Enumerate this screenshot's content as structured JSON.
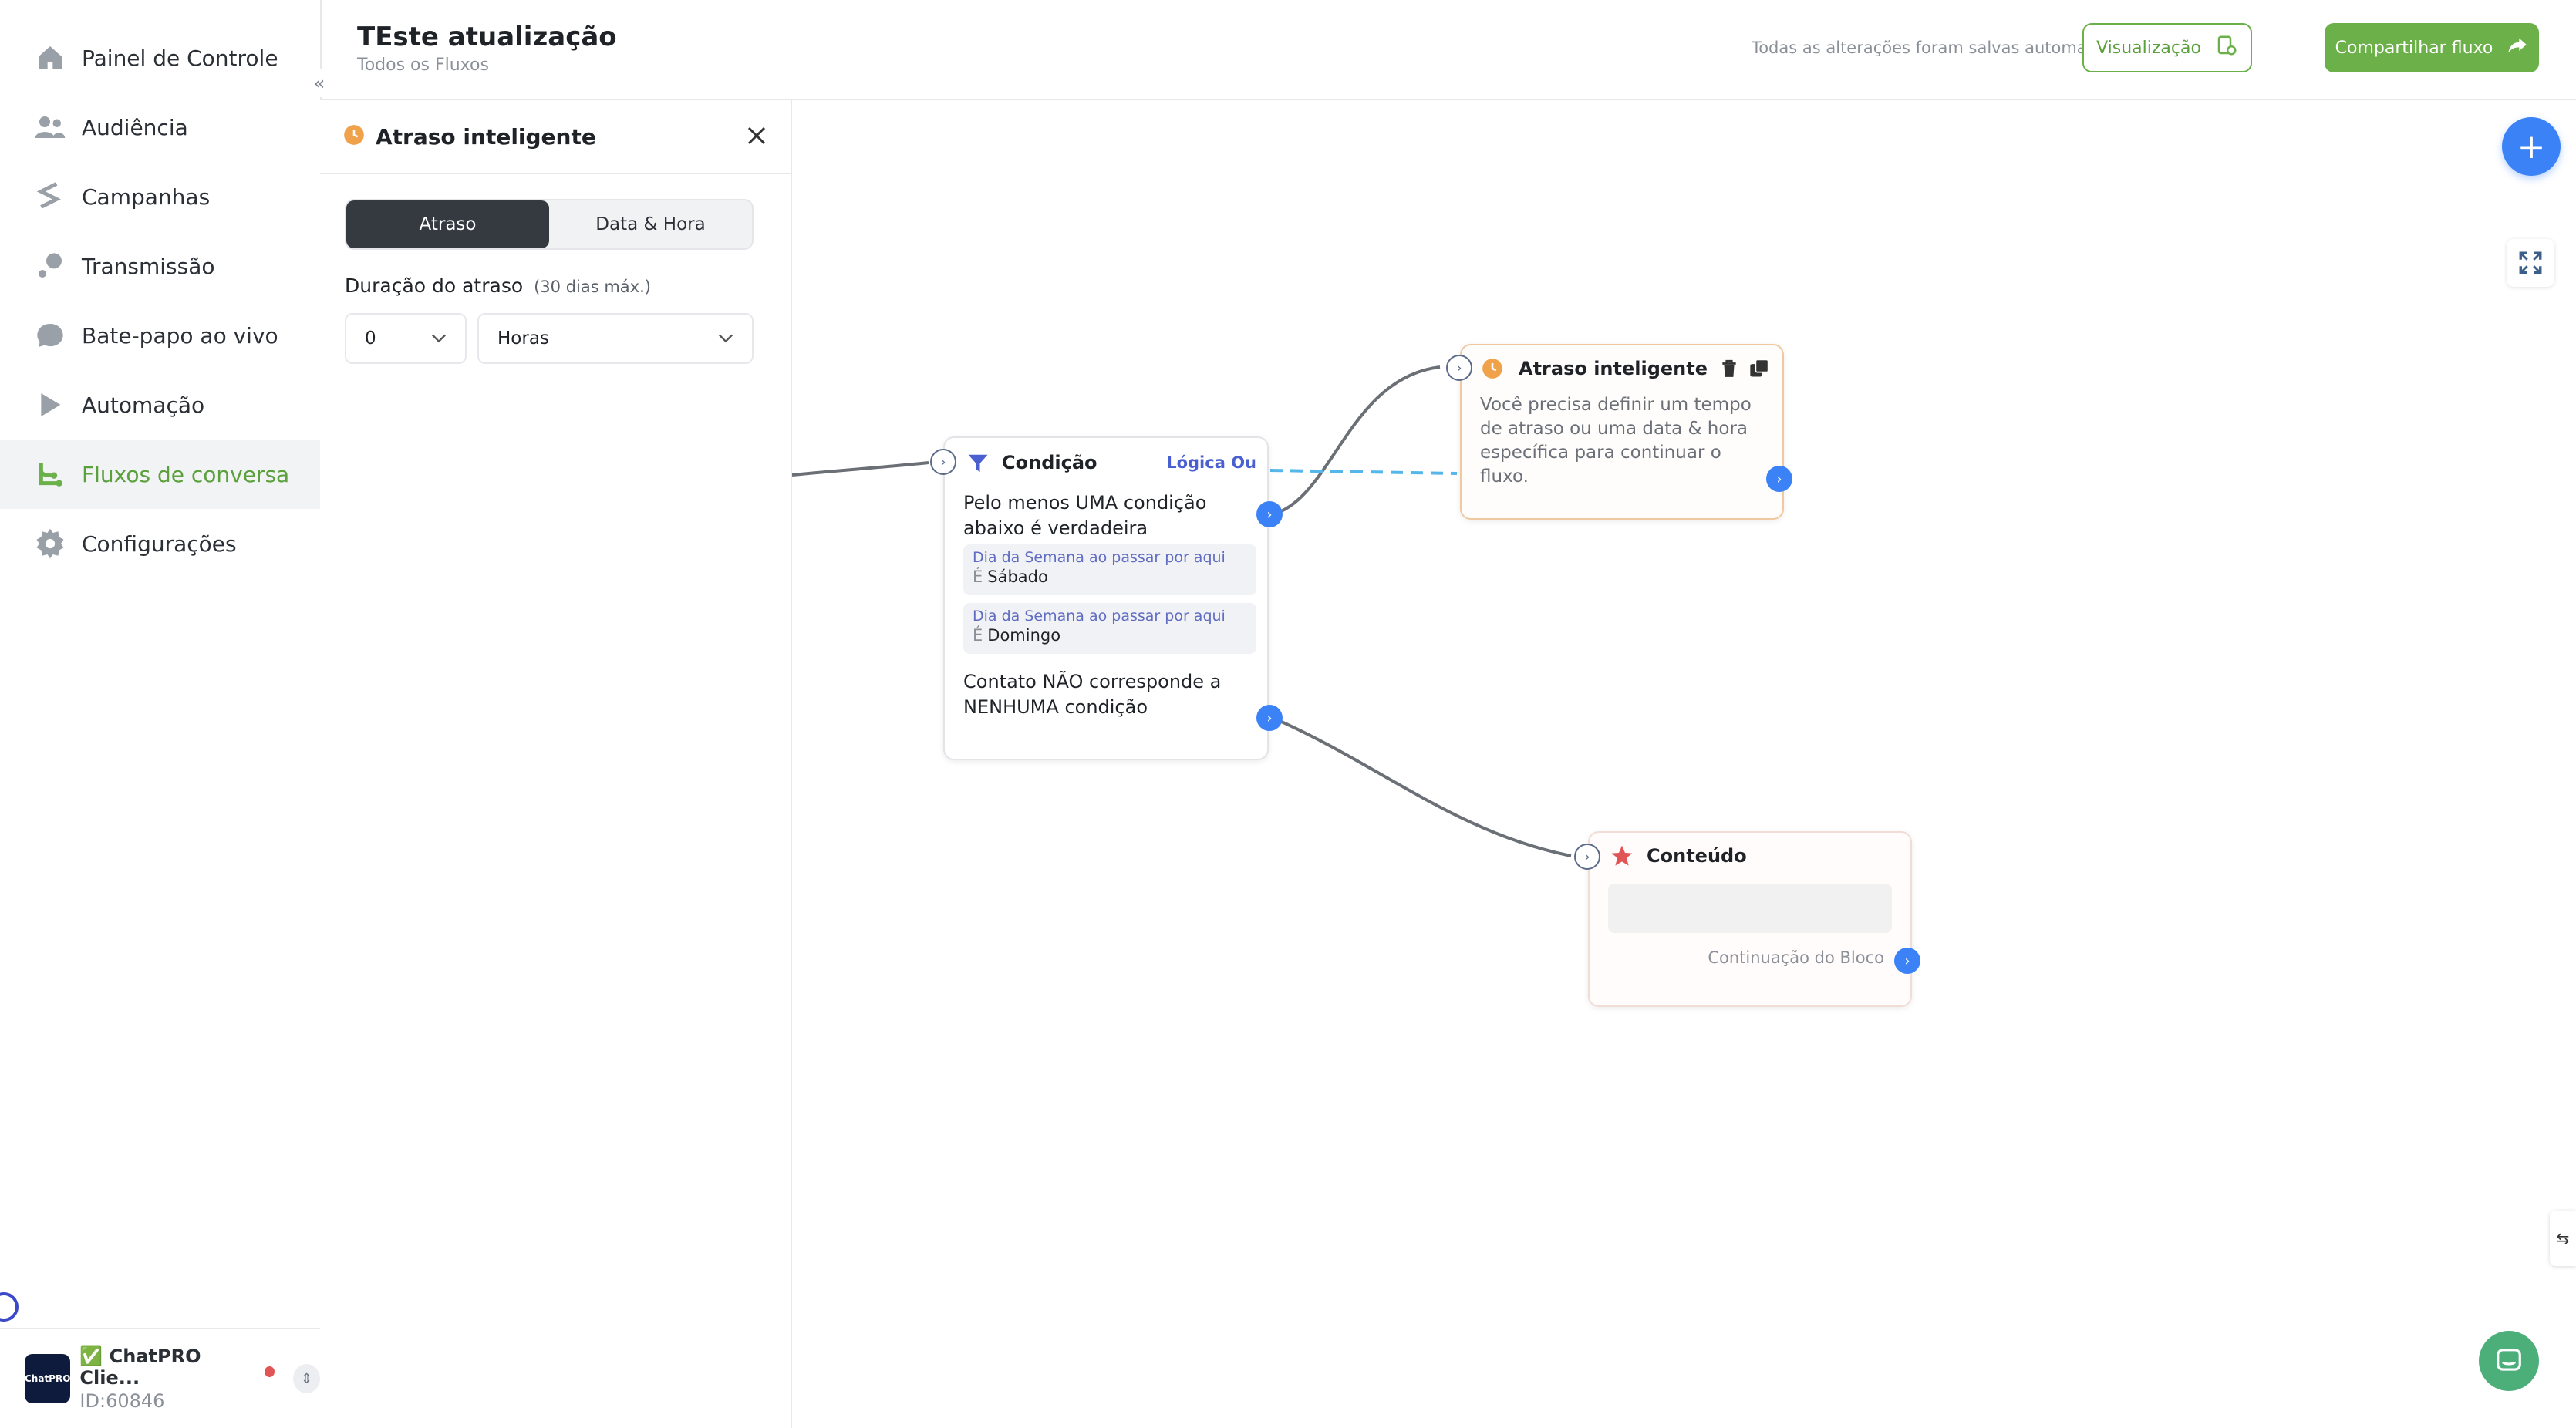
{
  "sidebar": {
    "items": [
      {
        "label": "Painel de Controle",
        "icon": "home-icon"
      },
      {
        "label": "Audiência",
        "icon": "users-icon"
      },
      {
        "label": "Campanhas",
        "icon": "campaign-icon"
      },
      {
        "label": "Transmissão",
        "icon": "broadcast-icon"
      },
      {
        "label": "Bate-papo ao vivo",
        "icon": "chat-bubble-icon"
      },
      {
        "label": "Automação",
        "icon": "play-icon"
      },
      {
        "label": "Fluxos de conversa",
        "icon": "flow-icon"
      },
      {
        "label": "Configurações",
        "icon": "gear-icon"
      }
    ],
    "active_index": 6,
    "account": {
      "name": "✅ ChatPRO Clie...",
      "id": "ID:60846",
      "avatar_text": "ChatPRO"
    }
  },
  "header": {
    "title": "TEste atualização",
    "subtitle": "Todos os Fluxos",
    "autosave": "Todas as alterações foram salvas automaticamente",
    "preview_label": "Visualização",
    "share_label": "Compartilhar fluxo"
  },
  "panel": {
    "title": "Atraso inteligente",
    "tabs": [
      "Atraso",
      "Data & Hora"
    ],
    "active_tab": 0,
    "duration_label": "Duração do atraso",
    "duration_max": "(30 dias máx.)",
    "amount_value": "0",
    "unit_value": "Horas"
  },
  "canvas": {
    "condition_node": {
      "title": "Condição",
      "logic": "Lógica Ou",
      "true_text": "Pelo menos UMA condição abaixo é verdadeira",
      "chips": [
        {
          "field": "Dia da Semana ao passar por aqui",
          "op": "É",
          "value": "Sábado"
        },
        {
          "field": "Dia da Semana ao passar por aqui",
          "op": "É",
          "value": "Domingo"
        }
      ],
      "false_text": "Contato NÃO corresponde a NENHUMA condição"
    },
    "delay_node": {
      "title": "Atraso inteligente",
      "body": "Você precisa definir um tempo de atraso ou uma data & hora específica para continuar o fluxo."
    },
    "content_node": {
      "title": "Conteúdo",
      "continuation": "Continuação do Bloco"
    }
  },
  "colors": {
    "accent": "#6cb04a",
    "link_blue": "#3b82f6",
    "dashed_wire": "#55b6ea",
    "delay_icon": "#f0a24a",
    "content_icon": "#e05656"
  }
}
